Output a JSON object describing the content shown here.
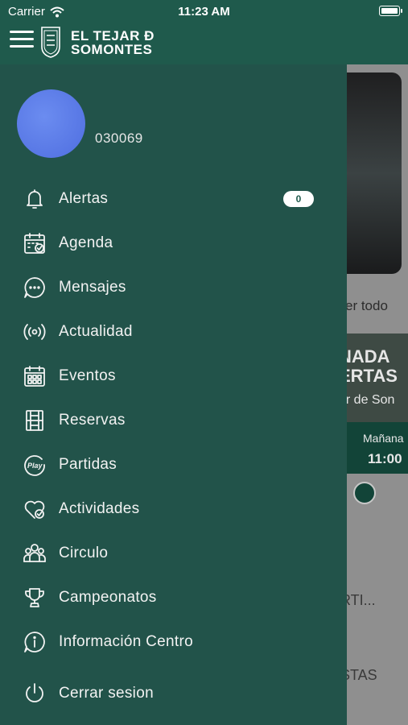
{
  "status_bar": {
    "carrier": "Carrier",
    "time": "11:23 AM"
  },
  "header": {
    "brand_line1": "EL TEJAR Ð",
    "brand_line2": "SOMONTES"
  },
  "profile": {
    "user_id": "030069"
  },
  "menu": {
    "items": [
      {
        "label": "Alertas",
        "icon": "bell-icon",
        "badge": "0"
      },
      {
        "label": "Agenda",
        "icon": "calendar-check-icon"
      },
      {
        "label": "Mensajes",
        "icon": "chat-bubble-icon"
      },
      {
        "label": "Actualidad",
        "icon": "broadcast-icon"
      },
      {
        "label": "Eventos",
        "icon": "calendar-grid-icon"
      },
      {
        "label": "Reservas",
        "icon": "court-icon"
      },
      {
        "label": "Partidas",
        "icon": "play-badge-icon"
      },
      {
        "label": "Actividades",
        "icon": "heart-check-icon"
      },
      {
        "label": "Circulo",
        "icon": "group-icon"
      },
      {
        "label": "Campeonatos",
        "icon": "trophy-icon"
      },
      {
        "label": "Información Centro",
        "icon": "info-icon"
      },
      {
        "label": "Cerrar sesion",
        "icon": "power-icon"
      }
    ]
  },
  "background": {
    "see_all": "er todo",
    "banner_line1": "NADA",
    "banner_line2": "ERTAS",
    "banner_line3": "ar de Son",
    "slot_day": "Mañana",
    "slot_time": "11:00",
    "row1": "RTI...",
    "row2": "STAS"
  },
  "colors": {
    "header": "#1f5a4c",
    "drawer": "#22534a",
    "avatar": "#5a7be8"
  }
}
